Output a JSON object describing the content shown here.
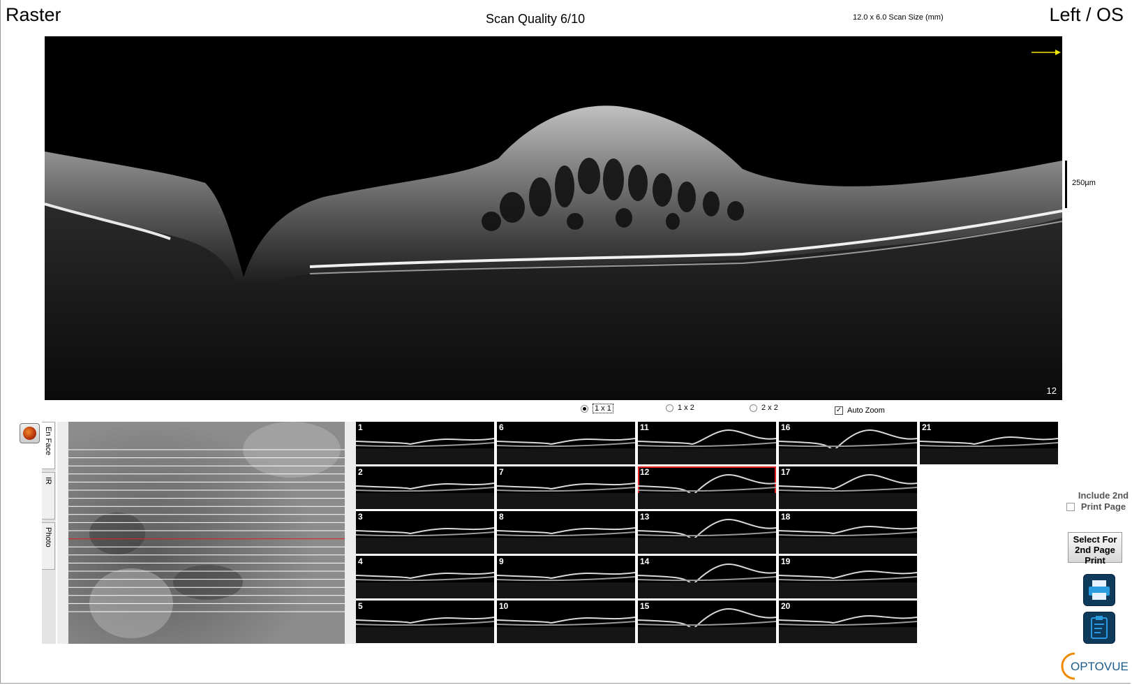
{
  "header": {
    "mode": "Raster",
    "quality": "Scan Quality 6/10",
    "scan_size": "12.0 x 6.0 Scan Size (mm)",
    "eye": "Left / OS"
  },
  "main_scan": {
    "number": "12",
    "scale_label": "250µm",
    "arrow_color": "#f2e600"
  },
  "layout_options": [
    {
      "label": "1 x 1",
      "selected": true
    },
    {
      "label": "1 x 2",
      "selected": false
    },
    {
      "label": "2 x 2",
      "selected": false
    }
  ],
  "auto_zoom": {
    "label": "Auto Zoom",
    "checked": true
  },
  "side_tabs": [
    "En Face",
    "IR",
    "Photo"
  ],
  "thumbnails": {
    "selected": "12",
    "highlight_color": "#e02020",
    "columns": [
      [
        "1",
        "2",
        "3",
        "4",
        "5"
      ],
      [
        "6",
        "7",
        "8",
        "9",
        "10"
      ],
      [
        "11",
        "12",
        "13",
        "14",
        "15"
      ],
      [
        "16",
        "17",
        "18",
        "19",
        "20"
      ],
      [
        "21"
      ]
    ]
  },
  "print_panel": {
    "include_label": "Include 2nd Print Page",
    "select_label": "Select For 2nd Page Print",
    "print_icon": "printer-icon",
    "report_icon": "clipboard-icon"
  },
  "logo": {
    "text": "OPTOVUE",
    "accent": "#f08a00"
  }
}
